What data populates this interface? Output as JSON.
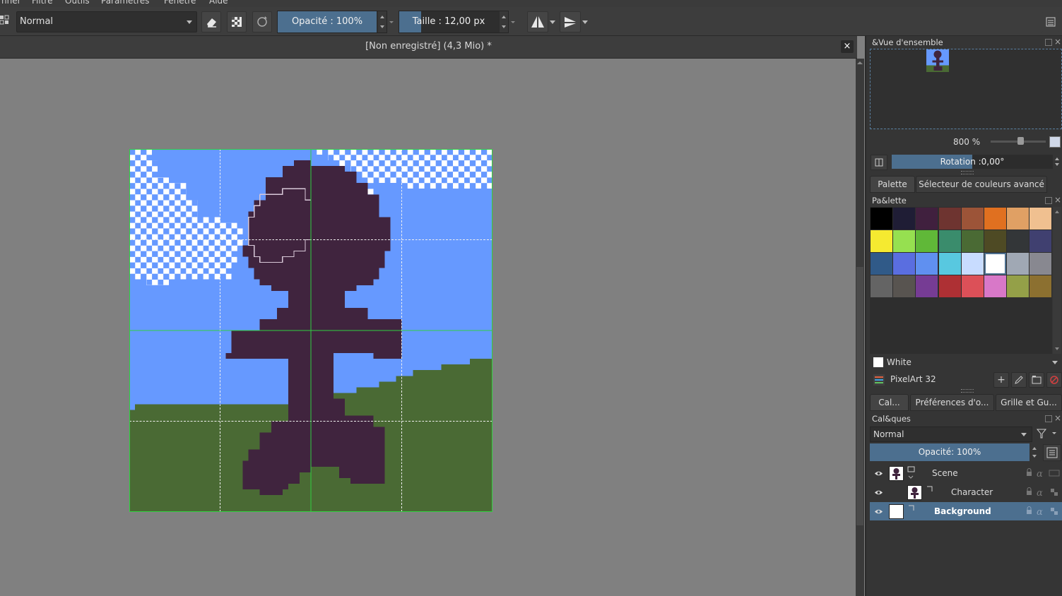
{
  "menu": {
    "items": [
      "nner",
      "Filtre",
      "Outils",
      "Paramètres",
      "Fenêtre",
      "Aide"
    ]
  },
  "toolbar": {
    "blend_mode": "Normal",
    "opacity_label": "Opacité : 100%",
    "opacity_value": 1.0,
    "size_label": "Taille : 12,00 px",
    "size_fill_fraction": 0.22
  },
  "document": {
    "title": "[Non enregistré]  (4,3 Mio) *"
  },
  "overview": {
    "title": "&Vue d'ensemble",
    "zoom": "800 %",
    "rotation": "Rotation :0,00°"
  },
  "palette_tabs": {
    "tabs": [
      "Palette",
      "Sélecteur de couleurs avancé"
    ],
    "title": "Pa&lette",
    "swatches": [
      "#000000",
      "#1f1d35",
      "#40203e",
      "#6e3430",
      "#9c5438",
      "#e07020",
      "#e0a064",
      "#f0c090",
      "#f5ea30",
      "#96e050",
      "#60b838",
      "#3a8c6c",
      "#4a6a34",
      "#4e4a24",
      "#333638",
      "#404070",
      "#305a88",
      "#5a6ee0",
      "#6090f0",
      "#58c8e0",
      "#c8dcff",
      "#ffffff",
      "#a0a8b4",
      "#888890",
      "#646464",
      "#585450",
      "#763c94",
      "#ae3034",
      "#dc5058",
      "#d878c8",
      "#94a048",
      "#8c7030"
    ],
    "selected_color_name": "White",
    "palette_name": "PixelArt 32"
  },
  "layers_tabs": {
    "tabs": [
      "Cal...",
      "Préférences d'o...",
      "Grille et Gu..."
    ],
    "title": "Cal&ques",
    "blend_mode": "Normal",
    "opacity": "Opacité:  100%",
    "layers": [
      {
        "name": "Scene"
      },
      {
        "name": "Character"
      },
      {
        "name": "Background"
      }
    ]
  },
  "colors": {
    "accent": "#4c6f8f",
    "sky": "#6699ff",
    "grass": "#4a6a34",
    "figure": "#40243e"
  }
}
